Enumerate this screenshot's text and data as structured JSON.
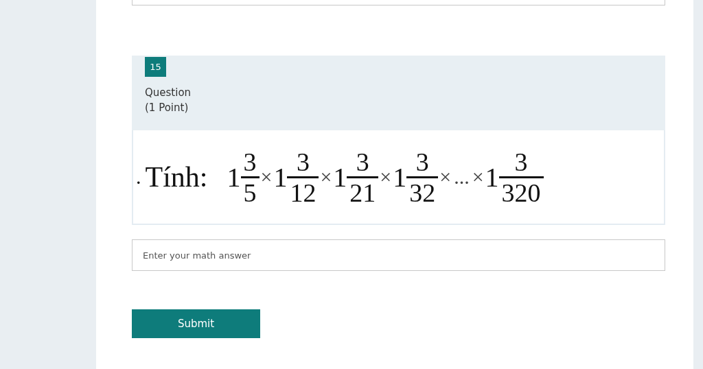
{
  "question": {
    "number": "15",
    "title": "Question",
    "points": "(1 Point)"
  },
  "expression": [
    {
      "kind": "text",
      "text": "."
    },
    {
      "kind": "text",
      "text": "Tính:"
    },
    {
      "kind": "mixed",
      "whole": "1",
      "numerator": "3",
      "denominator": "5"
    },
    {
      "kind": "op",
      "text": "×"
    },
    {
      "kind": "mixed",
      "whole": "1",
      "numerator": "3",
      "denominator": "12"
    },
    {
      "kind": "op",
      "text": "×"
    },
    {
      "kind": "mixed",
      "whole": "1",
      "numerator": "3",
      "denominator": "21"
    },
    {
      "kind": "op",
      "text": "×"
    },
    {
      "kind": "mixed",
      "whole": "1",
      "numerator": "3",
      "denominator": "32"
    },
    {
      "kind": "op",
      "text": "×"
    },
    {
      "kind": "op",
      "text": "..."
    },
    {
      "kind": "op",
      "text": "×"
    },
    {
      "kind": "mixed",
      "whole": "1",
      "numerator": "3",
      "denominator": "320"
    }
  ],
  "answer": {
    "placeholder": "Enter your math answer"
  },
  "submit": "Submit"
}
